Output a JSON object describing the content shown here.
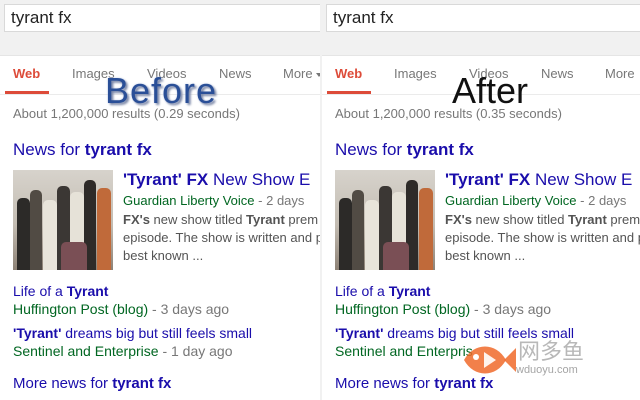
{
  "panels": [
    {
      "id": "before",
      "overlay_label": "Before",
      "search_query": "tyrant fx",
      "tabs": [
        {
          "label": "Web",
          "active": true
        },
        {
          "label": "Images"
        },
        {
          "label": "Videos"
        },
        {
          "label": "News"
        },
        {
          "label": "More"
        }
      ],
      "result_stats": "About 1,200,000 results (0.29 seconds)",
      "news_header": {
        "prefix": "News for ",
        "query": "tyrant fx"
      },
      "top_story": {
        "title_quoted": "'Tyrant'",
        "title_fx": "FX",
        "title_rest": "New Show E",
        "source": "Guardian Liberty Voice",
        "age": "- 2 days",
        "snippet_lines": [
          {
            "bold": "FX's",
            "text": " new show titled ",
            "bold2": "Tyrant",
            "text2": " prem"
          },
          {
            "text": "episode. The show is written and p"
          },
          {
            "text": "best known ..."
          }
        ]
      },
      "stories": [
        {
          "title_plain": "Life of a ",
          "title_bold": "Tyrant",
          "title_tail": "",
          "source": "Huffington Post (blog)",
          "age": "- 3 days ago"
        },
        {
          "title_plain": "",
          "title_bold": "'Tyrant'",
          "title_tail": " dreams big but still feels small",
          "source": "Sentinel and Enterprise",
          "age": "- 1 day ago"
        }
      ],
      "more_news": {
        "prefix": "More news for ",
        "query": "tyrant fx"
      }
    },
    {
      "id": "after",
      "overlay_label": "After",
      "search_query": "tyrant fx",
      "tabs": [
        {
          "label": "Web",
          "active": true
        },
        {
          "label": "Images"
        },
        {
          "label": "Videos"
        },
        {
          "label": "News"
        },
        {
          "label": "More"
        }
      ],
      "result_stats": "About 1,200,000 results (0.35 seconds)",
      "news_header": {
        "prefix": "News for ",
        "query": "tyrant fx"
      },
      "top_story": {
        "title_quoted": "'Tyrant'",
        "title_fx": "FX",
        "title_rest": "New Show E",
        "source": "Guardian Liberty Voice",
        "age": "- 2 days",
        "snippet_lines": [
          {
            "bold": "FX's",
            "text": " new show titled ",
            "bold2": "Tyrant",
            "text2": " prem"
          },
          {
            "text": "episode. The show is written and p"
          },
          {
            "text": "best known ..."
          }
        ]
      },
      "stories": [
        {
          "title_plain": "Life of a ",
          "title_bold": "Tyrant",
          "title_tail": "",
          "source": "Huffington Post (blog)",
          "age": "- 3 days ago"
        },
        {
          "title_plain": "",
          "title_bold": "'Tyrant'",
          "title_tail": " dreams big but still feels small",
          "source": "Sentinel and Enterpris",
          "age": ""
        }
      ],
      "more_news": {
        "prefix": "More news for ",
        "query": "tyrant fx"
      }
    }
  ],
  "watermark": {
    "text": "网多鱼",
    "url": "wduoyu.com"
  },
  "colors": {
    "link": "#1a0dab",
    "url_green": "#006621",
    "tab_active": "#dd4b39",
    "muted": "#777777"
  }
}
